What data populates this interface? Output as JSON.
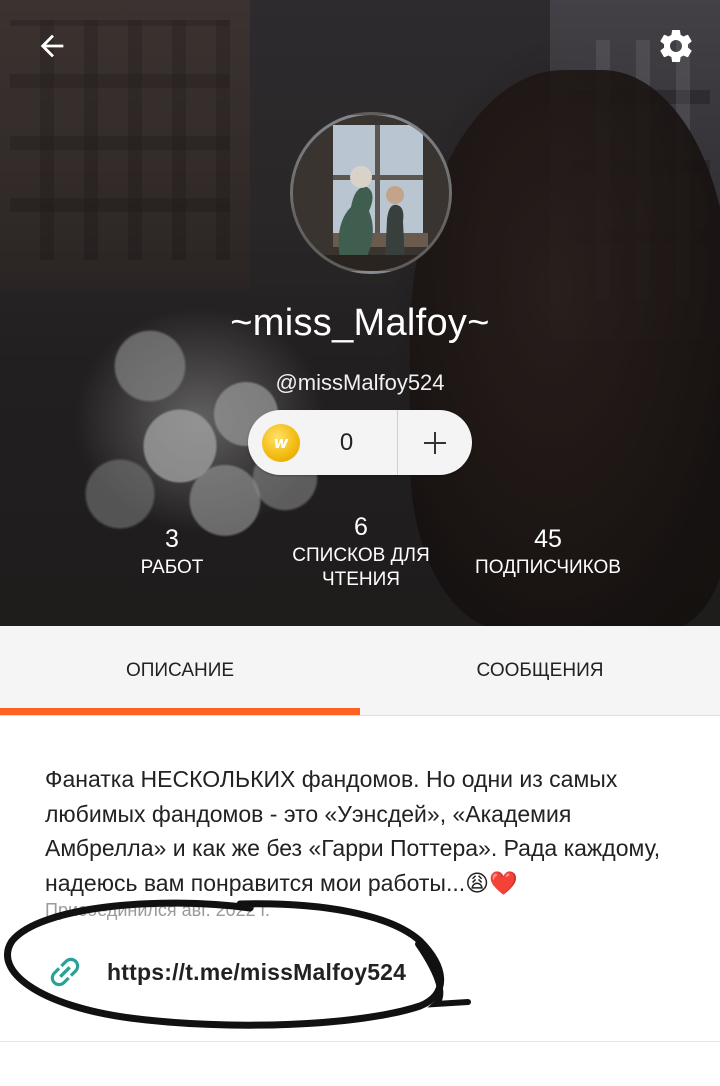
{
  "profile": {
    "display_name": "~miss_Malfoy~",
    "username": "@missMalfoy524",
    "coins": {
      "count": "0",
      "add_label": "+"
    },
    "stats": {
      "works": {
        "value": "3",
        "label": "РАБОТ"
      },
      "reading_lists": {
        "value": "6",
        "label": "СПИСКОВ ДЛЯ ЧТЕНИЯ"
      },
      "followers": {
        "value": "45",
        "label": "ПОДПИСЧИКОВ"
      }
    }
  },
  "toolbar": {
    "back_icon": "arrow-back-icon",
    "settings_icon": "gear-icon"
  },
  "tabs": [
    {
      "label": "ОПИСАНИЕ",
      "active": true
    },
    {
      "label": "СООБЩЕНИЯ",
      "active": false
    }
  ],
  "about": {
    "bio": "Фанатка НЕСКОЛЬКИХ фандомов. Но одни из самых любимых фандомов - это «Уэнсдей», «Академия Амбрелла» и как же без «Гарри Поттера». Рада каждому, надеюсь вам понравится мои работы...😩❤️",
    "joined": "Присоединился авг. 2022 г.",
    "link": "https://t.me/missMalfoy524"
  },
  "colors": {
    "accent": "#ff6122",
    "coin": "#f2b90c",
    "link_icon": "#2aa198"
  }
}
